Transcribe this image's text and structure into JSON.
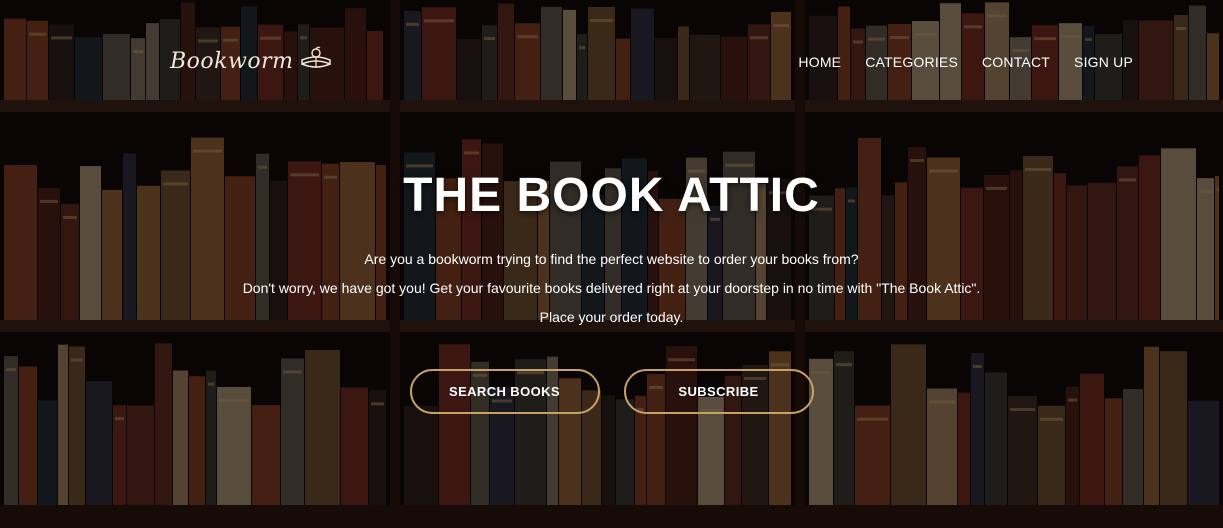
{
  "brand": {
    "name": "Bookworm",
    "icon": "book-icon"
  },
  "nav": {
    "items": [
      {
        "label": "HOME"
      },
      {
        "label": "CATEGORIES"
      },
      {
        "label": "CONTACT"
      },
      {
        "label": "SIGN UP"
      }
    ]
  },
  "hero": {
    "title": "THE BOOK ATTIC",
    "lines": [
      "Are you a bookworm trying to find the perfect website to order your books from?",
      "Don't worry, we have got you! Get your favourite books delivered right at your doorstep in no time with \"The Book Attic\".",
      "Place your order today."
    ],
    "buttons": [
      {
        "label": "SEARCH BOOKS"
      },
      {
        "label": "SUBSCRIBE"
      }
    ]
  },
  "colors": {
    "accent": "#c7a064",
    "text": "#ffffff",
    "background": "#0b0706"
  }
}
